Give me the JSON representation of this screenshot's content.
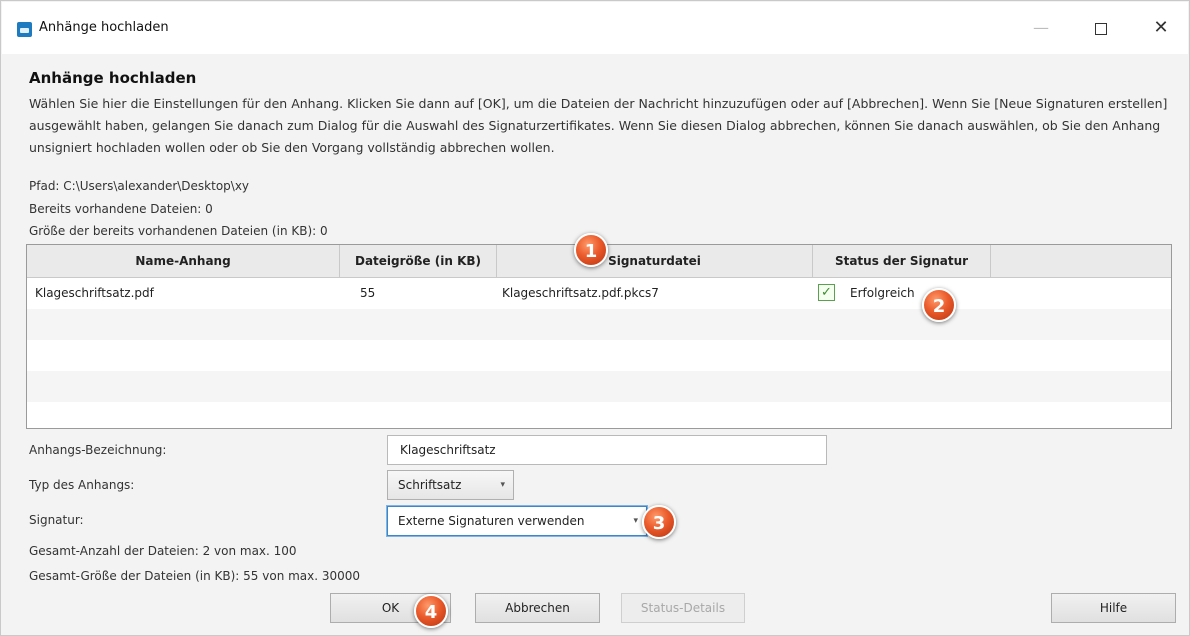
{
  "window": {
    "title": "Anhänge hochladen",
    "minimize_icon": "minimize-icon",
    "maximize_icon": "maximize-icon",
    "close_glyph": "✕"
  },
  "dialog": {
    "heading": "Anhänge hochladen",
    "description": "Wählen Sie hier die Einstellungen für den Anhang. Klicken Sie dann auf [OK], um die Dateien der Nachricht hinzuzufügen oder auf [Abbrechen]. Wenn Sie [Neue Signaturen erstellen] ausgewählt haben, gelangen Sie danach zum Dialog für die Auswahl des Signaturzertifikates. Wenn Sie diesen Dialog abbrechen, können Sie danach auswählen, ob Sie den Anhang unsigniert hochladen wollen oder ob Sie den Vorgang vollständig abbrechen wollen.",
    "path": "Pfad: C:\\Users\\alexander\\Desktop\\xy",
    "existing_files": "Bereits vorhandene Dateien: 0",
    "existing_size": "Größe der bereits vorhandenen Dateien (in KB): 0"
  },
  "table": {
    "headers": [
      "Name-Anhang",
      "Dateigröße (in KB)",
      "Signaturdatei",
      "Status der Signatur"
    ],
    "rows": [
      {
        "name": "Klageschriftsatz.pdf",
        "size": "55",
        "signature_file": "Klageschriftsatz.pdf.pkcs7",
        "status_checkmark": "✓",
        "status": "Erfolgreich"
      }
    ]
  },
  "form": {
    "label_name": "Anhangs-Bezeichnung:",
    "value_name": "Klageschriftsatz",
    "label_type": "Typ des Anhangs:",
    "value_type": "Schriftsatz",
    "label_signature": "Signatur:",
    "value_signature": "Externe Signaturen verwenden",
    "total_count": "Gesamt-Anzahl der Dateien: 2 von max. 100",
    "total_size": "Gesamt-Größe der Dateien (in KB): 55 von max. 30000"
  },
  "buttons": {
    "ok": "OK",
    "cancel": "Abbrechen",
    "status_details": "Status-Details",
    "help": "Hilfe"
  },
  "callouts": [
    "1",
    "2",
    "3",
    "4"
  ],
  "colors": {
    "callout": "#e4572e",
    "header_bg": "#eaeaea",
    "focus": "#3d86c8",
    "check": "#3c8d2f"
  },
  "icons": {
    "app": "app-icon",
    "dropdown": "▾",
    "check": "checkbox-icon"
  }
}
